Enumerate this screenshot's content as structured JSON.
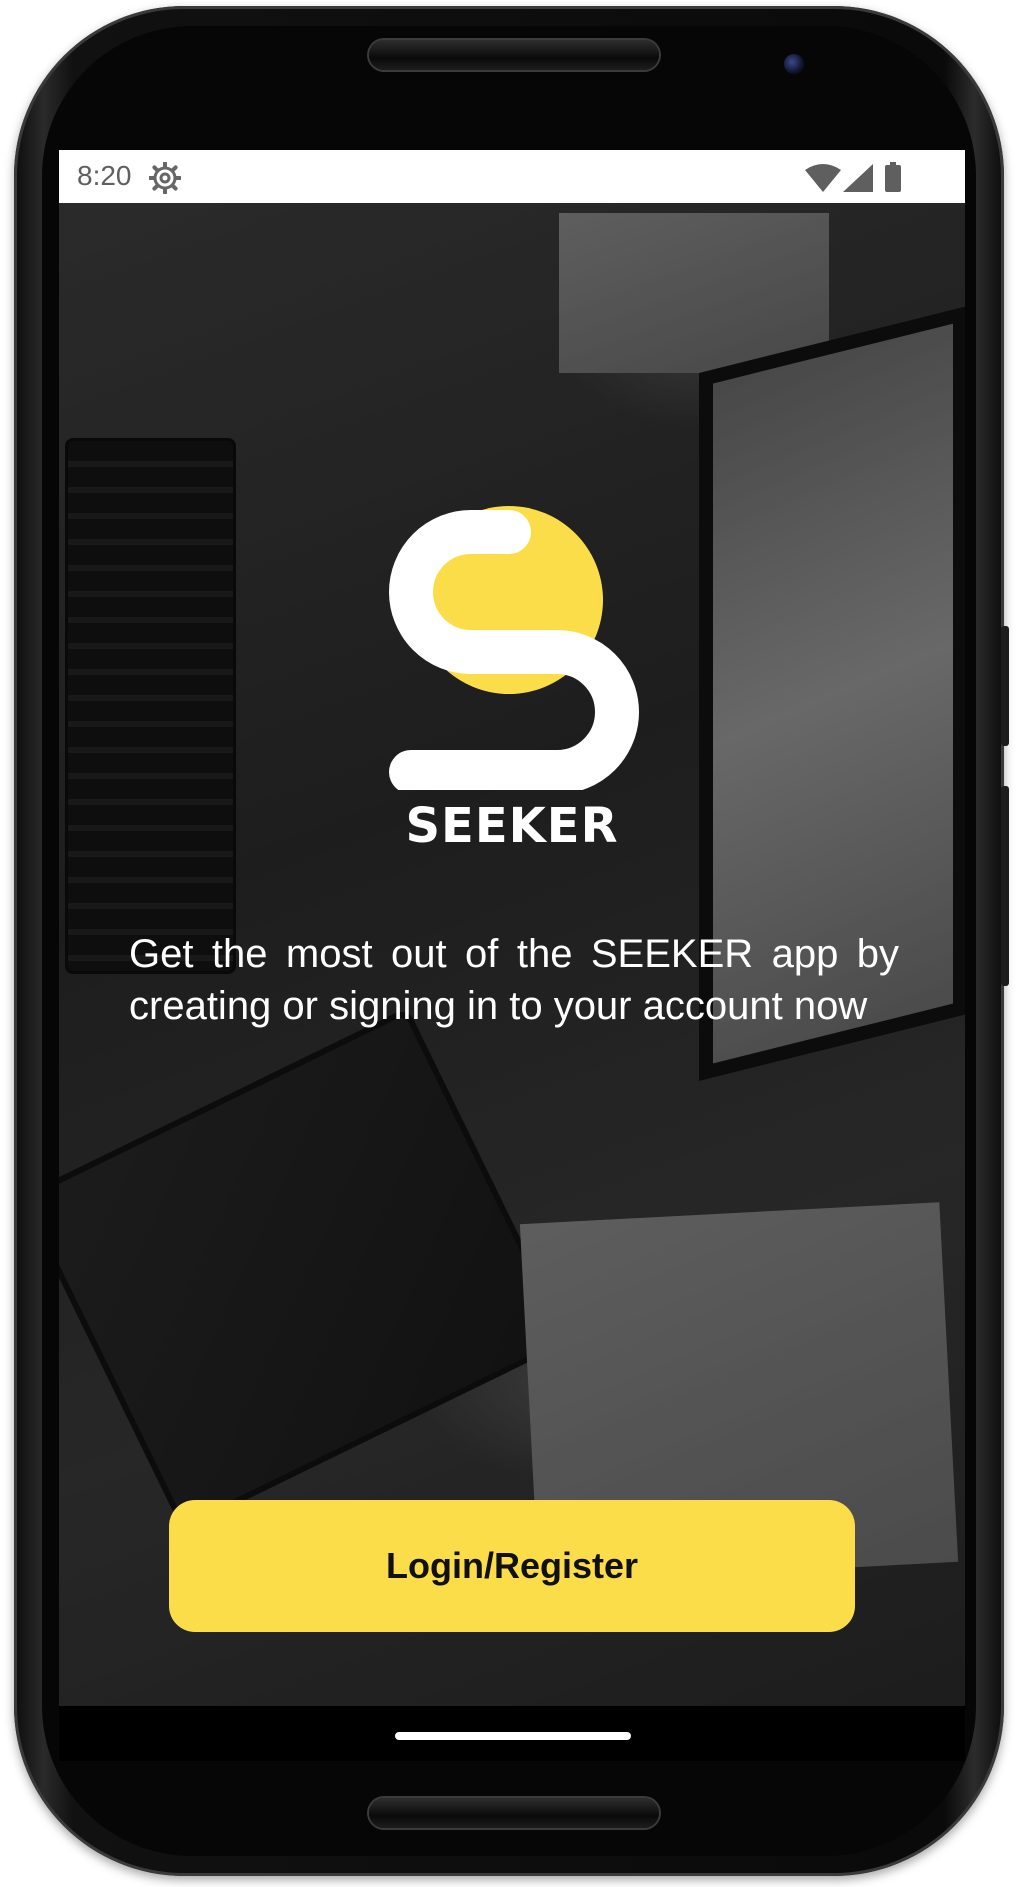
{
  "status_bar": {
    "time": "8:20",
    "icons": [
      "gear-icon",
      "wifi-icon",
      "cell-signal-icon",
      "battery-icon"
    ]
  },
  "app": {
    "brand": "SEEKER",
    "tagline": "Get the most out of the SEEKER app by creating or signing in to your account now",
    "login_button": "Login/Register"
  },
  "colors": {
    "accent": "#fbdd49",
    "logo_white": "#ffffff",
    "text": "#ffffff"
  }
}
